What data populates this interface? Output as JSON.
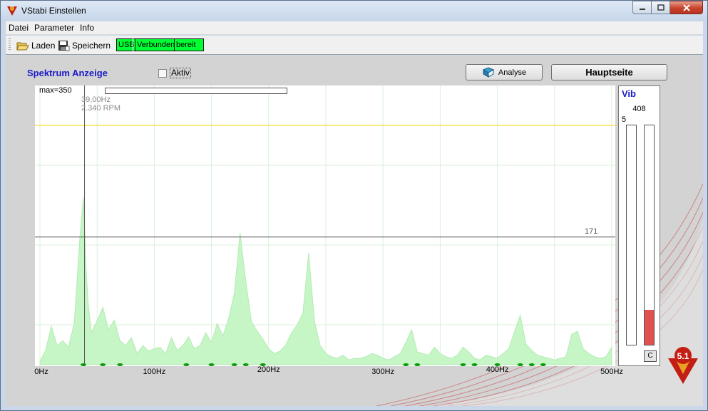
{
  "window": {
    "title": "VStabi Einstellen",
    "app_icon": "vstabi-logo-icon"
  },
  "menu": [
    "Datei",
    "Parameter",
    "Info"
  ],
  "toolbar": {
    "load_label": "Laden",
    "save_label": "Speichern",
    "status": {
      "usb": "USB",
      "connected": "Verbunden",
      "ready": "bereit"
    }
  },
  "spectrum": {
    "title": "Spektrum Anzeige",
    "aktiv_label": "Aktiv",
    "aktiv_checked": false,
    "analyse_label": "Analyse",
    "hauptseite_label": "Hauptseite",
    "max_label": "max=350",
    "cursor_hz": "39,00Hz",
    "cursor_rpm": "2.340 RPM",
    "level_label": "171"
  },
  "chart_data": {
    "type": "area",
    "xlabel": "",
    "ylabel": "",
    "xlim": [
      0,
      500
    ],
    "ylim": [
      0,
      350
    ],
    "x_ticks": [
      "0Hz",
      "100Hz",
      "200Hz",
      "300Hz",
      "400Hz",
      "500Hz"
    ],
    "threshold_lines": [
      300,
      160
    ],
    "cursor_x": 39,
    "fill_color": "#c6f5c6",
    "x": [
      0,
      5,
      10,
      15,
      20,
      25,
      30,
      35,
      38,
      40,
      42,
      45,
      50,
      55,
      60,
      65,
      70,
      75,
      80,
      85,
      90,
      95,
      100,
      105,
      110,
      115,
      120,
      125,
      130,
      135,
      140,
      145,
      150,
      155,
      160,
      165,
      170,
      175,
      180,
      185,
      190,
      195,
      200,
      205,
      210,
      215,
      220,
      225,
      230,
      235,
      240,
      245,
      250,
      255,
      260,
      265,
      270,
      275,
      280,
      285,
      290,
      295,
      300,
      305,
      310,
      315,
      320,
      325,
      330,
      335,
      340,
      345,
      350,
      355,
      360,
      365,
      370,
      375,
      380,
      385,
      390,
      395,
      400,
      405,
      410,
      415,
      420,
      425,
      430,
      435,
      440,
      445,
      450,
      455,
      460,
      465,
      470,
      475,
      480,
      485,
      490,
      495,
      500
    ],
    "y": [
      4,
      18,
      48,
      24,
      30,
      22,
      52,
      160,
      210,
      130,
      80,
      40,
      55,
      72,
      44,
      56,
      30,
      24,
      34,
      14,
      24,
      17,
      20,
      22,
      14,
      34,
      18,
      24,
      35,
      20,
      24,
      40,
      28,
      52,
      36,
      58,
      90,
      165,
      105,
      54,
      42,
      32,
      20,
      14,
      17,
      25,
      40,
      50,
      65,
      140,
      55,
      24,
      14,
      10,
      8,
      12,
      6,
      8,
      8,
      10,
      14,
      12,
      8,
      6,
      10,
      14,
      28,
      44,
      16,
      14,
      12,
      22,
      14,
      10,
      8,
      12,
      22,
      16,
      8,
      6,
      12,
      10,
      8,
      14,
      20,
      42,
      62,
      26,
      18,
      12,
      10,
      8,
      6,
      8,
      10,
      38,
      42,
      20,
      14,
      10,
      8,
      10,
      22
    ]
  },
  "vib": {
    "title": "Vib",
    "value": "408",
    "small_label": "5",
    "bar_left_level": 0,
    "bar_right_level": 0.16,
    "reset_label": "C"
  },
  "colors": {
    "title_blue": "#1a1ac8",
    "status_green": "#00ff33",
    "threshold_yellow": "#f5d400",
    "vib_red": "#e05050"
  }
}
